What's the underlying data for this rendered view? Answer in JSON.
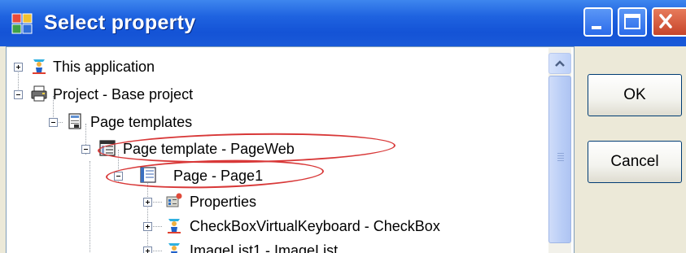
{
  "window": {
    "title": "Select property",
    "buttons": {
      "minimize_icon": "minimize-icon",
      "maximize_icon": "maximize-icon",
      "close_icon": "close-icon"
    }
  },
  "tree": {
    "items": [
      {
        "label": "This application",
        "icon": "application-icon",
        "expander": "plus"
      },
      {
        "label": "Project - Base project",
        "icon": "project-icon",
        "expander": "minus"
      },
      {
        "label": "Page templates",
        "icon": "page-templates-icon",
        "expander": "minus"
      },
      {
        "label": "Page template - PageWeb",
        "icon": "page-template-icon",
        "expander": "minus",
        "highlighted": true
      },
      {
        "label": "Page - Page1",
        "icon": "page-icon",
        "expander": "minus",
        "highlighted": true
      },
      {
        "label": "Properties",
        "icon": "properties-icon",
        "expander": "plus"
      },
      {
        "label": "CheckBoxVirtualKeyboard - CheckBox",
        "icon": "checkbox-icon",
        "expander": "plus"
      },
      {
        "label": "ImageList1 - ImageList",
        "icon": "imagelist-icon",
        "expander": "plus"
      }
    ]
  },
  "dialog": {
    "ok_label": "OK",
    "cancel_label": "Cancel"
  },
  "colors": {
    "titlebar": "#1f63e0",
    "annotation": "#d83838",
    "dialog_bg": "#ece9d8"
  }
}
